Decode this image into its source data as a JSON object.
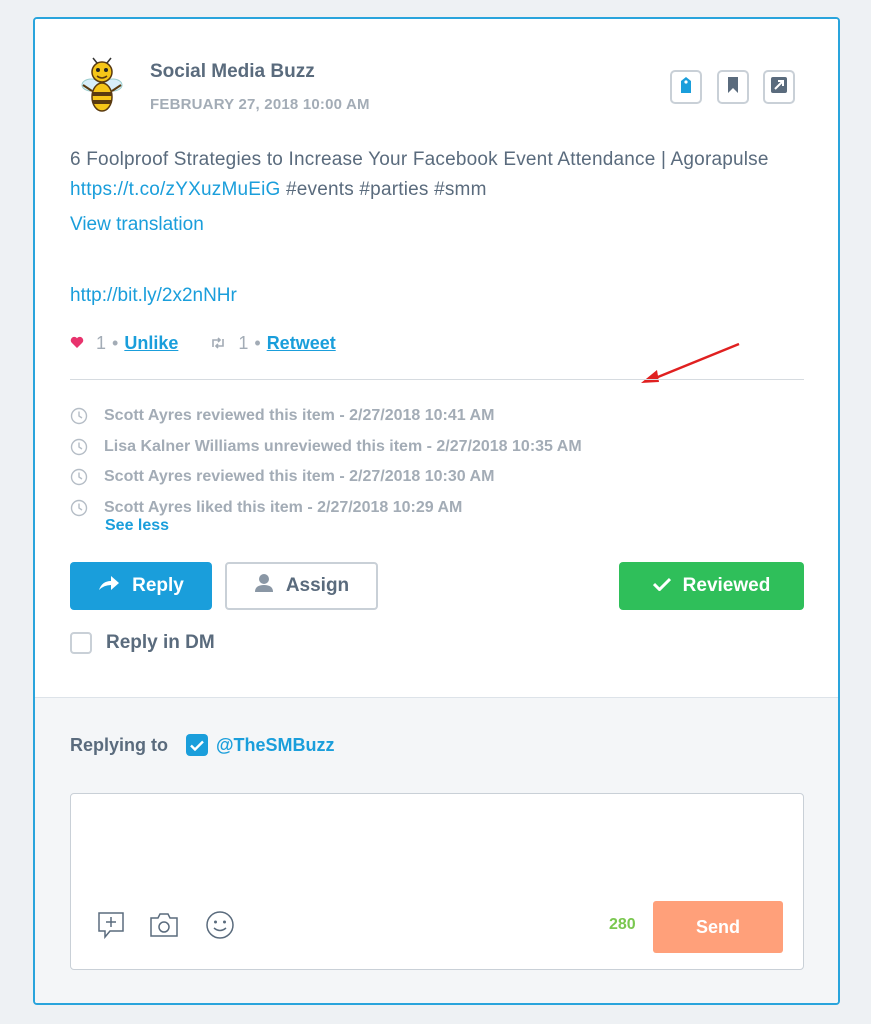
{
  "post": {
    "author": "Social Media Buzz",
    "date": "FEBRUARY 27, 2018 10:00 AM",
    "text_before_link": "6 Foolproof Strategies to Increase Your Facebook Event Attendance | Agorapulse ",
    "inline_link": "https://t.co/zYXuzMuEiG",
    "text_after_link": " #events #parties #smm",
    "view_translation": "View translation",
    "short_link": "http://bit.ly/2x2nNHr"
  },
  "engagement": {
    "likes": "1",
    "like_action": "Unlike",
    "retweets": "1",
    "retweet_action": "Retweet",
    "separator": "•"
  },
  "history": [
    "Scott Ayres reviewed this item - 2/27/2018 10:41 AM",
    "Lisa Kalner Williams unreviewed this item - 2/27/2018 10:35 AM",
    "Scott Ayres reviewed this item - 2/27/2018 10:30 AM",
    "Scott Ayres liked this item - 2/27/2018 10:29 AM"
  ],
  "see_less": "See less",
  "actions": {
    "reply": "Reply",
    "assign": "Assign",
    "reviewed": "Reviewed",
    "reply_in_dm": "Reply in DM"
  },
  "composer": {
    "replying_to_label": "Replying to",
    "replying_to_handle": "@TheSMBuzz",
    "text": "",
    "char_count": "280",
    "send": "Send"
  },
  "colors": {
    "accent": "#1a9edb",
    "reviewed": "#2fbf5a",
    "send": "#ffa07a",
    "heart": "#e8336d",
    "counter": "#7ac74f",
    "annotation_arrow": "#e02020"
  },
  "icons": [
    "bee-avatar",
    "tag-icon",
    "bookmark-icon",
    "expand-icon",
    "heart-icon",
    "retweet-icon",
    "clock-icon",
    "reply-arrow-icon",
    "user-icon",
    "checkmark-icon",
    "add-note-icon",
    "camera-icon",
    "emoji-icon"
  ]
}
